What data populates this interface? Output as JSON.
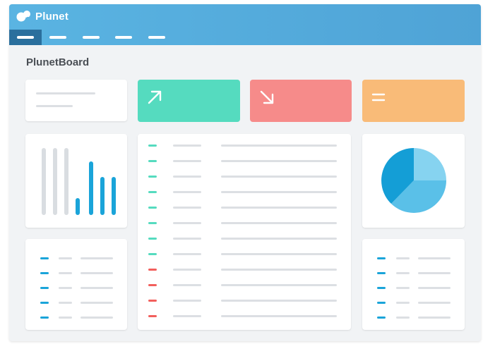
{
  "app": {
    "brand": "Plunet",
    "board_title": "PlunetBoard"
  },
  "nav": {
    "tabs": [
      {
        "active": true
      },
      {
        "active": false
      },
      {
        "active": false
      },
      {
        "active": false
      },
      {
        "active": false
      }
    ]
  },
  "kpis": [
    {
      "icon": "arrow-up-right-icon",
      "color": "#55dbbf"
    },
    {
      "icon": "arrow-down-right-icon",
      "color": "#f68b8a"
    },
    {
      "icon": "equals-icon",
      "color": "#f9bb78"
    }
  ],
  "bar_chart": {
    "gray_bars": 3,
    "blue_bar_levels": [
      0.25,
      0.8,
      0.57,
      0.57
    ]
  },
  "pie_chart": {
    "slice_shares": [
      0.25,
      0.33,
      0.42
    ]
  },
  "colors": {
    "teal": "#55dbbf",
    "red": "#f25f5c",
    "blue": "#1aa4d9",
    "gray_line": "#dcdfe3",
    "header": "#5ab4e2"
  }
}
